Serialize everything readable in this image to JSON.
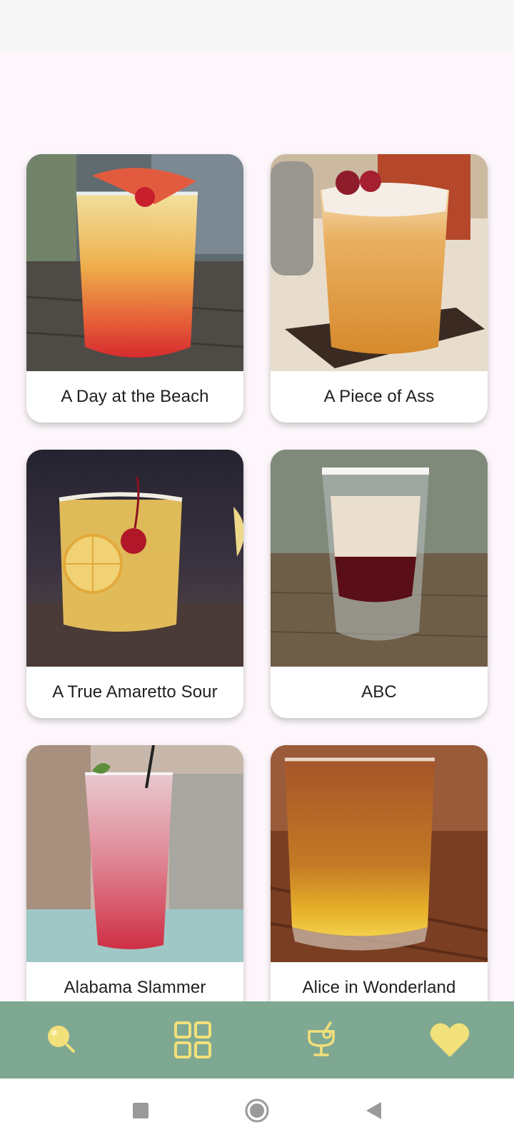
{
  "cocktails": [
    {
      "name": "A Day at the Beach",
      "icon": "cocktail-photo"
    },
    {
      "name": "A Piece of Ass",
      "icon": "cocktail-photo"
    },
    {
      "name": "A True Amaretto Sour",
      "icon": "cocktail-photo"
    },
    {
      "name": "ABC",
      "icon": "cocktail-photo"
    },
    {
      "name": "Alabama Slammer",
      "icon": "cocktail-photo"
    },
    {
      "name": "Alice in Wonderland",
      "icon": "cocktail-photo"
    }
  ],
  "bottom_nav": {
    "items": [
      {
        "icon": "search-icon"
      },
      {
        "icon": "grid-icon",
        "selected": true
      },
      {
        "icon": "cocktail-glass-icon"
      },
      {
        "icon": "heart-icon"
      }
    ]
  },
  "system_nav": {
    "items": [
      {
        "icon": "recents-square-icon"
      },
      {
        "icon": "home-circle-icon"
      },
      {
        "icon": "back-triangle-icon"
      }
    ]
  },
  "colors": {
    "background": "#fdf7fb",
    "bottom_nav": "#7fa892",
    "nav_icon": "#f2e07a",
    "card": "#ffffff"
  }
}
